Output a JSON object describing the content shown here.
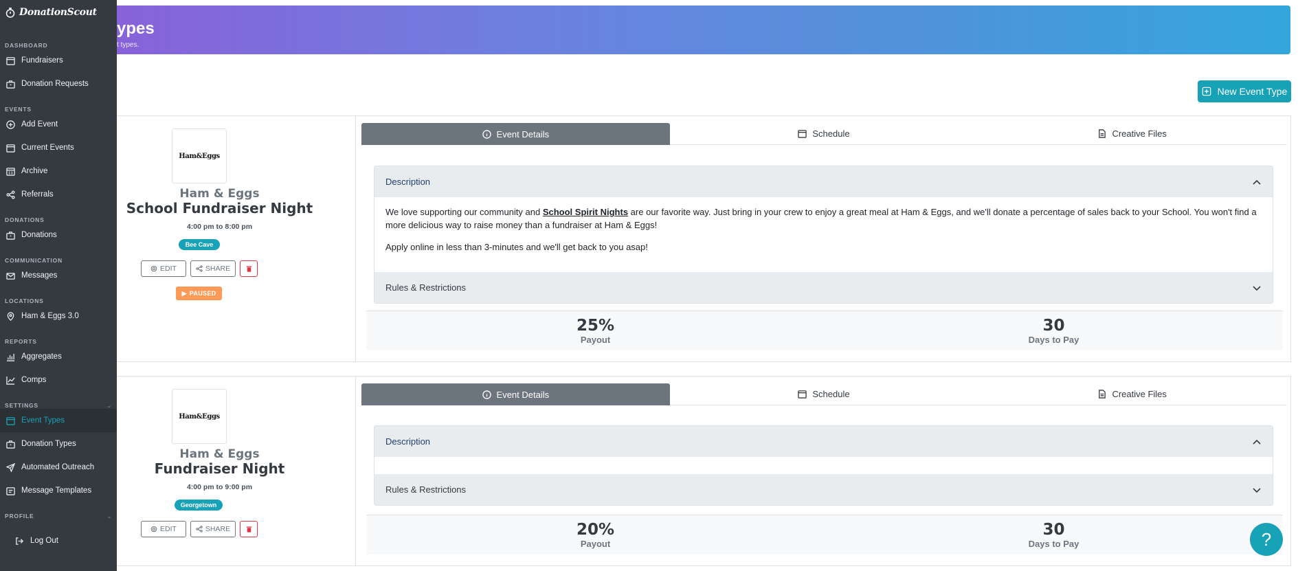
{
  "brand": {
    "name": "DonationScout"
  },
  "header": {
    "title_visible": "ypes",
    "subtitle_visible": "t types."
  },
  "sidebar": {
    "sections": [
      {
        "label": "DASHBOARD",
        "items": [
          {
            "label": "Fundraisers",
            "icon": "calendar-icon"
          },
          {
            "label": "Donation Requests",
            "icon": "briefcase-icon"
          }
        ]
      },
      {
        "label": "EVENTS",
        "items": [
          {
            "label": "Add Event",
            "icon": "plus-circle-icon"
          },
          {
            "label": "Current Events",
            "icon": "calendar-icon"
          },
          {
            "label": "Archive",
            "icon": "archive-icon"
          },
          {
            "label": "Referrals",
            "icon": "share-icon"
          }
        ]
      },
      {
        "label": "DONATIONS",
        "items": [
          {
            "label": "Donations",
            "icon": "briefcase-icon"
          }
        ]
      },
      {
        "label": "COMMUNICATION",
        "items": [
          {
            "label": "Messages",
            "icon": "mail-icon"
          }
        ]
      },
      {
        "label": "LOCATIONS",
        "items": [
          {
            "label": "Ham & Eggs 3.0",
            "icon": "map-pin-icon"
          }
        ]
      },
      {
        "label": "REPORTS",
        "items": [
          {
            "label": "Aggregates",
            "icon": "bar-chart-icon"
          },
          {
            "label": "Comps",
            "icon": "line-chart-icon"
          }
        ]
      },
      {
        "label": "SETTINGS",
        "items": [
          {
            "label": "Event Types",
            "icon": "calendar-icon"
          },
          {
            "label": "Donation Types",
            "icon": "briefcase-icon"
          },
          {
            "label": "Automated Outreach",
            "icon": "send-icon"
          },
          {
            "label": "Message Templates",
            "icon": "file-icon"
          }
        ]
      },
      {
        "label": "PROFILE",
        "items": [
          {
            "label": "Log Out",
            "icon": "logout-icon"
          }
        ]
      }
    ],
    "active": "Event Types"
  },
  "toolbar": {
    "new_label": "New Event Type"
  },
  "tabs": {
    "details": "Event Details",
    "schedule": "Schedule",
    "creative": "Creative Files"
  },
  "common": {
    "edit": "EDIT",
    "share": "SHARE",
    "description": "Description",
    "rules": "Rules & Restrictions",
    "payout_label": "Payout",
    "days_label": "Days to Pay",
    "logo_text": "Ham&Eggs"
  },
  "events": [
    {
      "business": "Ham & Eggs",
      "name": "School Fundraiser Night",
      "time": "4:00 pm to 8:00 pm",
      "location": "Bee Cave",
      "status": "PAUSED",
      "desc_pre": "We love supporting our community and ",
      "desc_link": "School Spirit Nights",
      "desc_post": " are our favorite way. Just bring in your crew to enjoy a great meal at Ham & Eggs, and we'll donate a percentage of sales back to your School. You won't find a more delicious way to raise money than a fundraiser at Ham & Eggs!",
      "desc_p2": "Apply online in less than 3-minutes and we'll get back to you asap!",
      "payout": "25%",
      "days": "30"
    },
    {
      "business": "Ham & Eggs",
      "name": "Fundraiser Night",
      "time": "4:00 pm to 9:00 pm",
      "location": "Georgetown",
      "payout": "20%",
      "days": "30"
    }
  ],
  "colors": {
    "accent": "#17a2b8",
    "sidebar": "#343a40",
    "paused": "#fd9a57",
    "danger": "#dc3545"
  }
}
